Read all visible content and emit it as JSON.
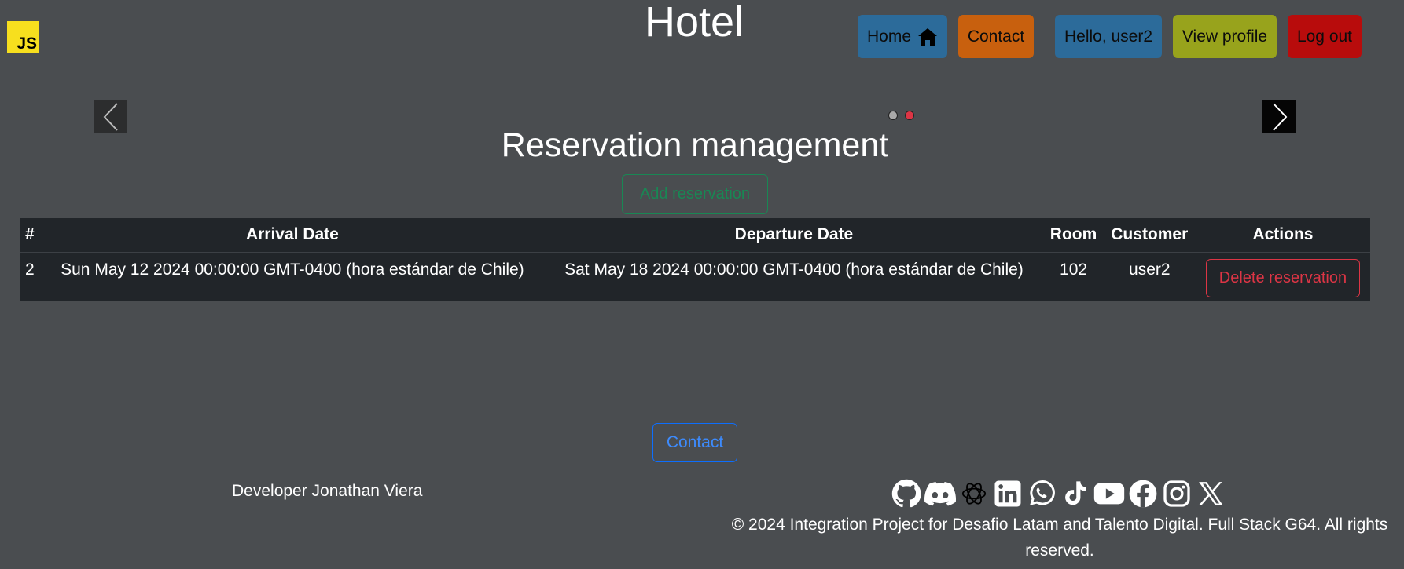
{
  "header": {
    "logo_text": "JS",
    "site_title": "Hotel"
  },
  "nav": {
    "home_label": "Home",
    "contact_label": "Contact",
    "greeting_label": "Hello, user2",
    "profile_label": "View profile",
    "logout_label": "Log out"
  },
  "colors": {
    "home": "#2c6b9a",
    "contact": "#c8600e",
    "greeting": "#2c6b9a",
    "profile": "#98a31c",
    "logout": "#b80c0c"
  },
  "carousel": {
    "active_slide": 2,
    "slide_count": 2
  },
  "main": {
    "heading": "Reservation management",
    "add_button": "Add reservation"
  },
  "table": {
    "columns": [
      "#",
      "Arrival Date",
      "Departure Date",
      "Room",
      "Customer",
      "Actions"
    ],
    "rows": [
      {
        "id": "2",
        "arrival": "Sun May 12 2024 00:00:00 GMT-0400 (hora estándar de Chile)",
        "departure": "Sat May 18 2024 00:00:00 GMT-0400 (hora estándar de Chile)",
        "room": "102",
        "customer": "user2",
        "action": "Delete reservation"
      }
    ]
  },
  "footer": {
    "contact_button": "Contact",
    "developer": "Developer Jonathan Viera",
    "social_icons": [
      "github-icon",
      "discord-icon",
      "openai-icon",
      "linkedin-icon",
      "whatsapp-icon",
      "tiktok-icon",
      "youtube-icon",
      "facebook-icon",
      "instagram-icon",
      "x-icon"
    ],
    "copyright": "© 2024 Integration Project for Desafio Latam and Talento Digital. Full Stack G64. All rights reserved."
  }
}
